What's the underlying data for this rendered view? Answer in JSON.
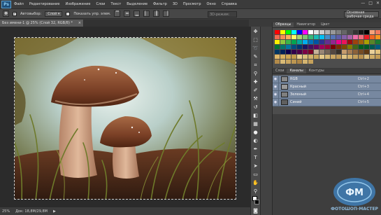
{
  "menubar": {
    "logo": "Ps",
    "items": [
      "Файл",
      "Редактирование",
      "Изображение",
      "Слои",
      "Текст",
      "Выделение",
      "Фильтр",
      "3D",
      "Просмотр",
      "Окно",
      "Справка"
    ],
    "controls": [
      "—",
      "□",
      "✕"
    ]
  },
  "options": {
    "autoselect_label": "Автовыбор:",
    "autoselect_value": "Слой",
    "transform_label": "Показать упр. элем.",
    "mode_label": "3D-режим:",
    "workspace": "Основная рабочая среда"
  },
  "document": {
    "tab_title": "Без имени-1 @ 25% (Слой 32, RGB/8) *",
    "close": "×"
  },
  "status": {
    "zoom": "25%",
    "doc_size": "Док: 18,8M/29,8M",
    "arrow": "▶"
  },
  "swatches_panel": {
    "tabs": [
      "Образцы",
      "Навигатор",
      "Цвет"
    ],
    "colors": [
      "#ff0000",
      "#ffff00",
      "#00ff00",
      "#00ffff",
      "#0000ff",
      "#ff00ff",
      "#ffffff",
      "#e5e5e5",
      "#cccccc",
      "#b2b2b2",
      "#999999",
      "#7f7f7f",
      "#666666",
      "#4c4c4c",
      "#333333",
      "#191919",
      "#000000",
      "#f6a27b",
      "#f2795d",
      "#f26c4f",
      "#f68e55",
      "#fbaf5c",
      "#fff467",
      "#acd372",
      "#7cc576",
      "#3bb878",
      "#1abbb4",
      "#00bff3",
      "#438ccb",
      "#5574b9",
      "#605ca8",
      "#855fa8",
      "#a763a8",
      "#f06ea9",
      "#f26d7d",
      "#ed1c24",
      "#f26522",
      "#f7941d",
      "#fff200",
      "#8dc63f",
      "#39b54a",
      "#00a651",
      "#00a99d",
      "#00aeef",
      "#0072bc",
      "#0054a6",
      "#2e3192",
      "#662d91",
      "#92278f",
      "#ec008c",
      "#ed145b",
      "#9e0b0f",
      "#a0410d",
      "#a3620a",
      "#aba000",
      "#598527",
      "#1a7b30",
      "#007236",
      "#00746b",
      "#0076a3",
      "#004b80",
      "#003471",
      "#1b1464",
      "#440e62",
      "#630460",
      "#9e005d",
      "#9e0039",
      "#790000",
      "#7b2e00",
      "#7d4900",
      "#827b00",
      "#406618",
      "#005e20",
      "#005826",
      "#005952",
      "#005b7f",
      "#003663",
      "#002157",
      "#0d004c",
      "#32004b",
      "#4b0049",
      "#7b0046",
      "#7a0026",
      "#c7b299",
      "#998675",
      "#736357",
      "#534741",
      "#37302a",
      "#c69c6d",
      "#a67c52",
      "#8c6239",
      "#754c24",
      "#603913",
      "#e9d09a",
      "#e3c27b",
      "#dfb86a",
      "#d9b15f",
      "#cfa654",
      "#c49b4a",
      "#e8cf90",
      "#dcc07a",
      "#d1b26a",
      "#c7a55c",
      "#e5c98a",
      "#d8b874",
      "#cba763",
      "#bd9756",
      "#e2c584",
      "#d4b26c",
      "#c6a15b",
      "#b8904e",
      "#ddbf7c",
      "#cfac66",
      "#c19b56",
      "#b38b4a",
      "#d9ba76",
      "#caa660",
      "#bc9651",
      "#ae8645",
      "#d4b470",
      "#c5a15b"
    ]
  },
  "layers_panel": {
    "tabs": [
      "Слои",
      "Каналы",
      "Контуры"
    ],
    "layers": [
      {
        "name": "RGB",
        "shortcut": "Ctrl+2",
        "thumb": "#8a8a8a"
      },
      {
        "name": "Красный",
        "shortcut": "Ctrl+3",
        "thumb": "#9a9a9a"
      },
      {
        "name": "Зеленый",
        "shortcut": "Ctrl+4",
        "thumb": "#7f7f7f"
      },
      {
        "name": "Синий",
        "shortcut": "Ctrl+5",
        "thumb": "#5f5f5f"
      }
    ]
  },
  "watermark": {
    "text": "ФОТОШОП-МАСТЕР"
  }
}
